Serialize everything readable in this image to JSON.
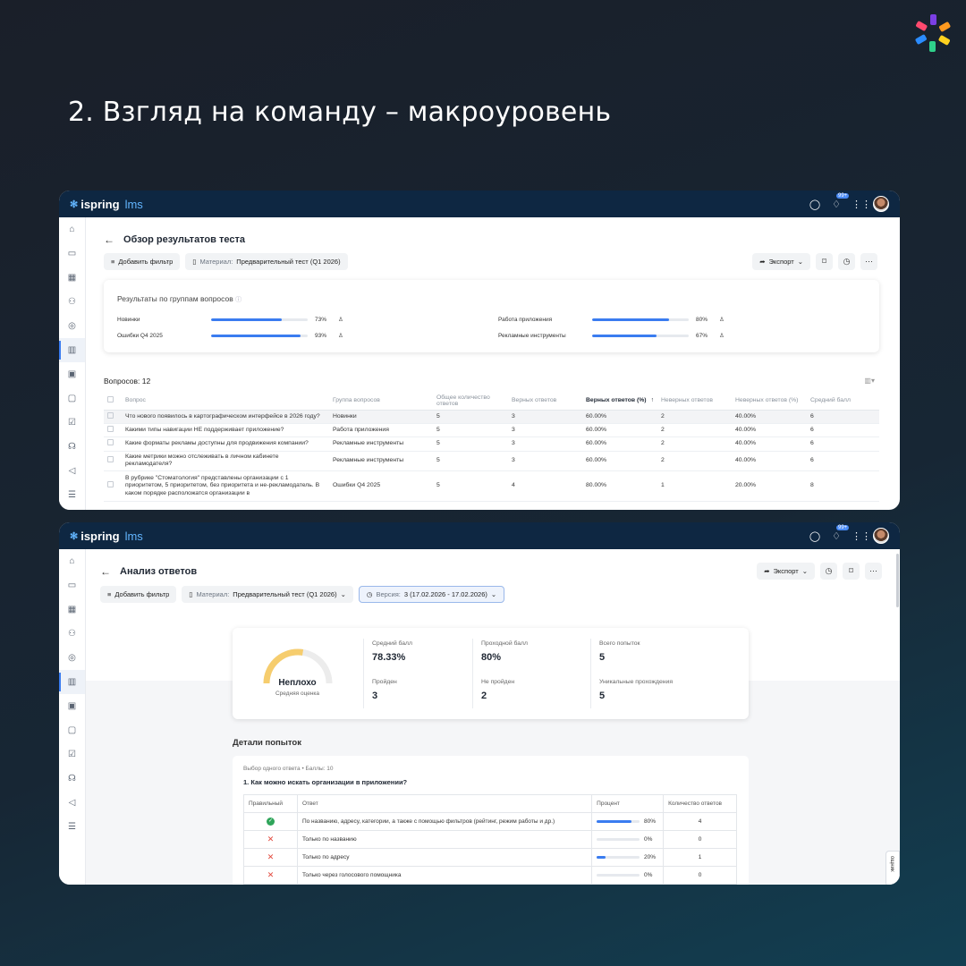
{
  "heading": "2. Взгляд на команду – макроуровень",
  "colors": {
    "accent": "#3a7cf0",
    "topbar": "#0e2742",
    "gauge": "#f6cd6e",
    "success": "#2fa55a",
    "error": "#e2473b"
  },
  "app": {
    "brand": "ispring",
    "brand_suffix": "lms",
    "notif_badge": "99+"
  },
  "screen1": {
    "title": "Обзор результатов теста",
    "add_filter": "Добавить фильтр",
    "material_label": "Материал:",
    "material_value": "Предварительный тест (Q1 2026)",
    "export": "Экспорт",
    "groups_title": "Результаты по группам вопросов",
    "groups": [
      {
        "name": "Новинки",
        "percent": 73,
        "label": "73%"
      },
      {
        "name": "Ошибки Q4 2025",
        "percent": 93,
        "label": "93%"
      },
      {
        "name": "Работа приложения",
        "percent": 80,
        "label": "80%"
      },
      {
        "name": "Рекламные инструменты",
        "percent": 67,
        "label": "67%"
      }
    ],
    "questions_count": "Вопросов: 12",
    "columns": [
      "Вопрос",
      "Группа вопросов",
      "Общее количество ответов",
      "Верных ответов",
      "Верных ответов (%)",
      "Неверных ответов",
      "Неверных ответов (%)",
      "Средний балл"
    ],
    "rows": [
      [
        "Что нового появилось в картографическом интерфейсе в 2026 году?",
        "Новинки",
        "5",
        "3",
        "60.00%",
        "2",
        "40.00%",
        "6"
      ],
      [
        "Какими типы навигации НЕ поддерживает приложение?",
        "Работа приложения",
        "5",
        "3",
        "60.00%",
        "2",
        "40.00%",
        "6"
      ],
      [
        "Какие форматы рекламы доступны для продвижения компании?",
        "Рекламные инструменты",
        "5",
        "3",
        "60.00%",
        "2",
        "40.00%",
        "6"
      ],
      [
        "Какие метрики можно отслеживать в личном кабинете рекламодателя?",
        "Рекламные инструменты",
        "5",
        "3",
        "60.00%",
        "2",
        "40.00%",
        "6"
      ],
      [
        "В рубрике \"Стоматология\" представлены организации с 1 приоритетом, 5 приоритетом, без приоритета и не-рекламодатель. В каком порядке расположатся организации в",
        "Ошибки Q4 2025",
        "5",
        "4",
        "80.00%",
        "1",
        "20.00%",
        "8"
      ]
    ]
  },
  "screen2": {
    "title": "Анализ ответов",
    "export": "Экспорт",
    "add_filter": "Добавить фильтр",
    "material_label": "Материал:",
    "material_value": "Предварительный тест (Q1 2026)",
    "version_label": "Версия:",
    "version_value": "3 (17.02.2026 - 17.02.2026)",
    "gauge": {
      "label": "Неплохо",
      "sub": "Средняя оценка",
      "fraction": 0.55
    },
    "stats": [
      {
        "label": "Средний балл",
        "value": "78.33%"
      },
      {
        "label": "Проходной балл",
        "value": "80%"
      },
      {
        "label": "Всего попыток",
        "value": "5"
      },
      {
        "label": "Пройден",
        "value": "3"
      },
      {
        "label": "Не пройден",
        "value": "2"
      },
      {
        "label": "Уникальные прохождения",
        "value": "5"
      }
    ],
    "details_title": "Детали попыток",
    "question_meta_type": "Выбор одного ответа",
    "question_meta_points": "Баллы: 10",
    "question_text": "1. Как можно искать организации в приложении?",
    "answer_columns": [
      "Правильный",
      "Ответ",
      "Процент",
      "Количество ответов"
    ],
    "answers": [
      {
        "correct": true,
        "text": "По названию, адресу, категории, а также с помощью фильтров (рейтинг, режим работы и др.)",
        "percent": 80,
        "percent_label": "80%",
        "count": "4"
      },
      {
        "correct": false,
        "text": "Только по названию",
        "percent": 0,
        "percent_label": "0%",
        "count": "0"
      },
      {
        "correct": false,
        "text": "Только по адресу",
        "percent": 20,
        "percent_label": "20%",
        "count": "1"
      },
      {
        "correct": false,
        "text": "Только через голосового помощника",
        "percent": 0,
        "percent_label": "0%",
        "count": "0"
      }
    ],
    "side_tab": "ощник"
  }
}
